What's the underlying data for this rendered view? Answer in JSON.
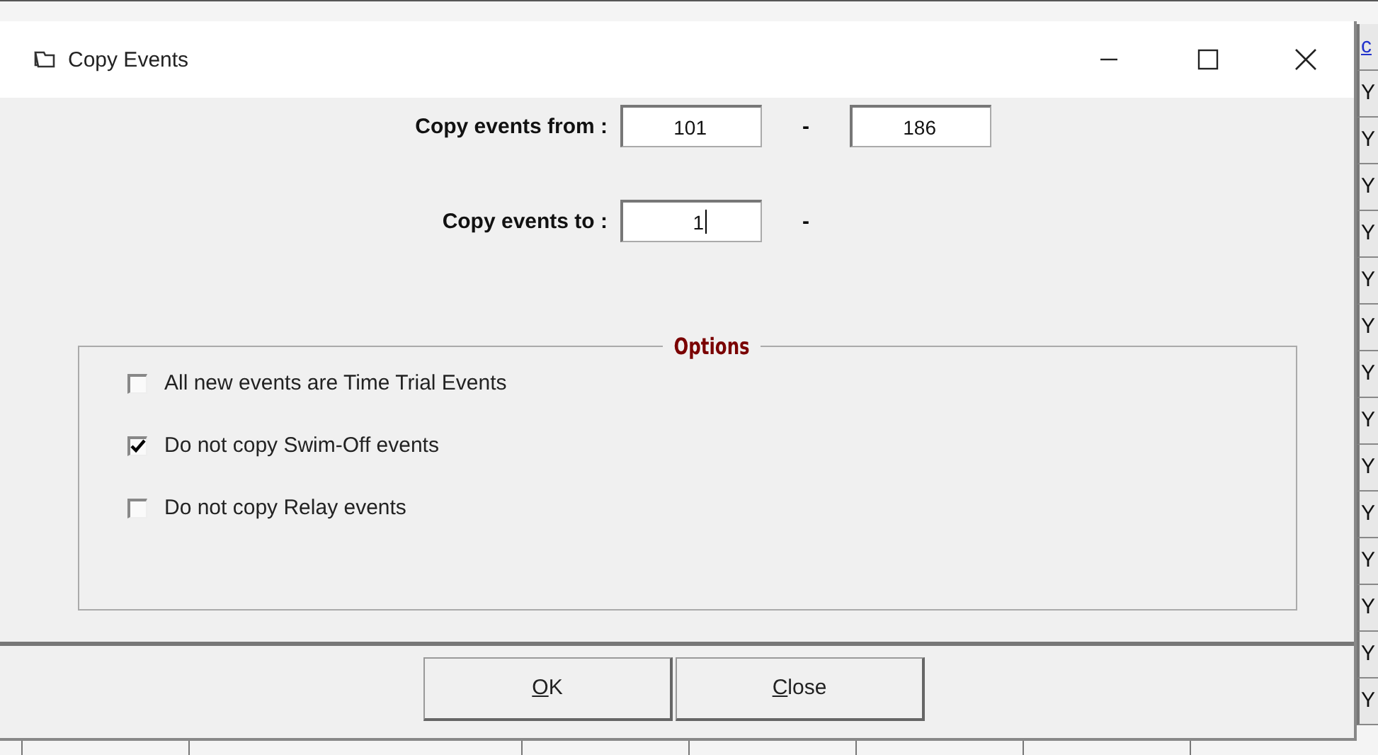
{
  "background_table": {
    "last_column_cells": [
      {
        "text": "c",
        "kind": "link"
      },
      {
        "text": "Y",
        "kind": "plain"
      },
      {
        "text": "Y",
        "kind": "plain"
      },
      {
        "text": "Y",
        "kind": "plain"
      },
      {
        "text": "Y",
        "kind": "plain"
      },
      {
        "text": "Y",
        "kind": "plain"
      },
      {
        "text": "Y",
        "kind": "plain"
      },
      {
        "text": "Y",
        "kind": "plain"
      },
      {
        "text": "Y",
        "kind": "plain"
      },
      {
        "text": "Y",
        "kind": "plain"
      },
      {
        "text": "Y",
        "kind": "plain"
      },
      {
        "text": "Y",
        "kind": "plain"
      },
      {
        "text": "Y",
        "kind": "plain"
      },
      {
        "text": "Y",
        "kind": "plain"
      },
      {
        "text": "Y",
        "kind": "plain"
      }
    ]
  },
  "dialog": {
    "title": "Copy Events",
    "fields": [
      {
        "label": "Copy events from :",
        "value": "101",
        "separator": "-",
        "value_end": "186",
        "focused": false
      },
      {
        "label": "Copy events to :",
        "value": "1",
        "separator": "-",
        "focused": true
      }
    ],
    "options": {
      "title": "Options",
      "items": [
        {
          "label": "All new events are Time Trial Events",
          "checked": false
        },
        {
          "label": "Do not copy Swim-Off events",
          "checked": true
        },
        {
          "label": "Do not copy Relay events",
          "checked": false
        }
      ]
    },
    "buttons": [
      {
        "access_key": "O",
        "label_rest": "K"
      },
      {
        "access_key": "C",
        "label_rest": "lose"
      }
    ]
  }
}
